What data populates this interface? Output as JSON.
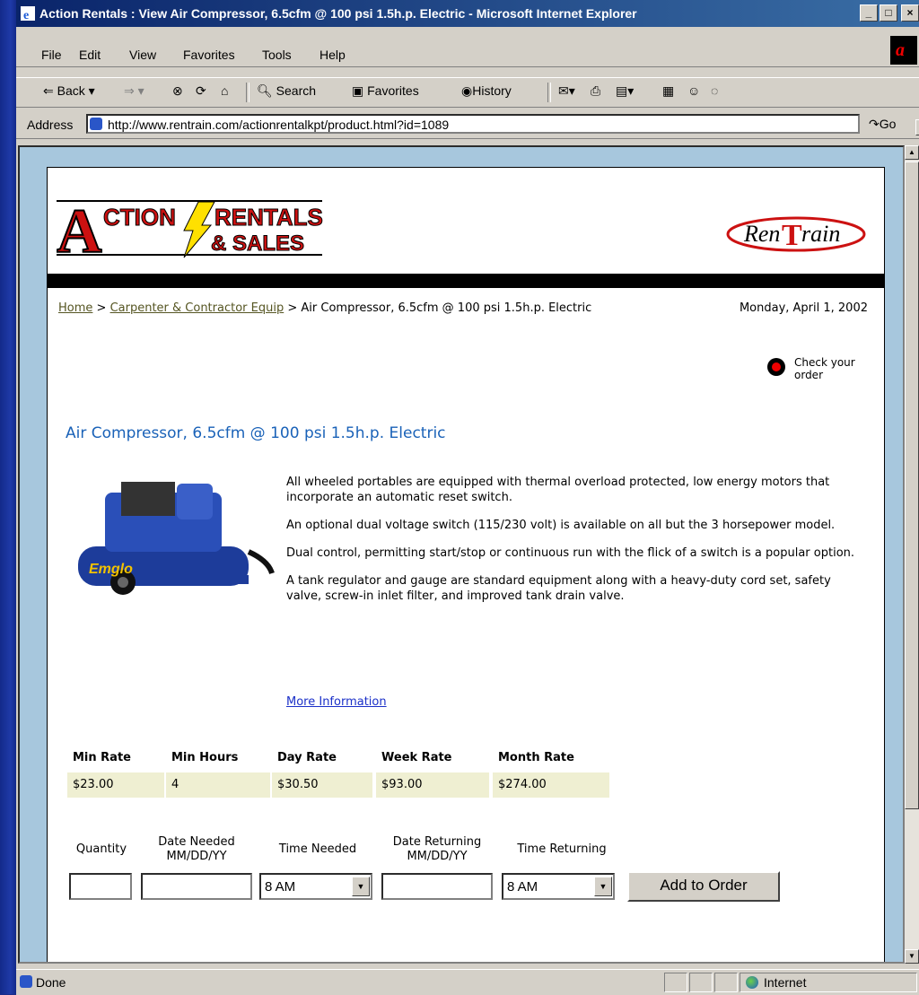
{
  "window": {
    "title": "Action Rentals : View Air Compressor, 6.5cfm @ 100 psi 1.5h.p. Electric - Microsoft Internet Explorer",
    "controls": {
      "minimize": "_",
      "maximize": "□",
      "close": "×"
    }
  },
  "menubar": {
    "items": [
      "File",
      "Edit",
      "View",
      "Favorites",
      "Tools",
      "Help"
    ]
  },
  "toolbar": {
    "back": "⇐ Back ▾",
    "forward": "⇒ ▾",
    "search": "Search",
    "favorites": "Favorites",
    "history": "History"
  },
  "address": {
    "label": "Address",
    "url": "http://www.rentrain.com/actionrentalkpt/product.html?id=1089",
    "go": "Go"
  },
  "page": {
    "logo_left": {
      "line1": "CTION",
      "big": "A",
      "line2": "RENTALS",
      "line3": "& SALES"
    },
    "logo_right": {
      "text1": "Ren",
      "text2": "rain",
      "t": "T"
    },
    "breadcrumb": {
      "home": "Home",
      "sep1": " > ",
      "category": "Carpenter & Contractor Equip",
      "sep2": " > ",
      "current": "Air Compressor, 6.5cfm @ 100 psi 1.5h.p. Electric"
    },
    "date": "Monday, April 1, 2002",
    "check_order": "Check your order",
    "product_title": "Air Compressor, 6.5cfm @ 100 psi 1.5h.p. Electric",
    "product_image_brand": "Emglo",
    "description": [
      "All wheeled portables are equipped with thermal overload protected, low energy motors that incorporate an automatic reset switch.",
      "An optional dual voltage switch (115/230 volt) is available on all but the 3 horsepower model.",
      "Dual control, permitting start/stop or continuous run with the flick of a switch is a popular option.",
      "A tank regulator and gauge are standard equipment along with a heavy-duty cord set, safety valve, screw-in inlet filter, and improved tank drain valve."
    ],
    "more_info": "More Information",
    "rates": {
      "headers": [
        "Min Rate",
        "Min Hours",
        "Day Rate",
        "Week Rate",
        "Month Rate"
      ],
      "values": [
        "$23.00",
        "4",
        "$30.50",
        "$93.00",
        "$274.00"
      ]
    },
    "order_form": {
      "quantity_label": "Quantity",
      "date_needed_label": "Date Needed",
      "date_needed_format": "MM/DD/YY",
      "time_needed_label": "Time Needed",
      "date_returning_label": "Date Returning",
      "date_returning_format": "MM/DD/YY",
      "time_returning_label": "Time Returning",
      "quantity_value": "",
      "date_needed_value": "",
      "time_needed_value": "8 AM",
      "date_returning_value": "",
      "time_returning_value": "8 AM",
      "submit": "Add to Order"
    }
  },
  "status": {
    "text": "Done",
    "zone": "Internet"
  },
  "colors": {
    "title_blue": "#1a62b8",
    "link_olive": "#555522",
    "rate_bg": "#efefd2",
    "page_bg": "#a7c7dd"
  }
}
